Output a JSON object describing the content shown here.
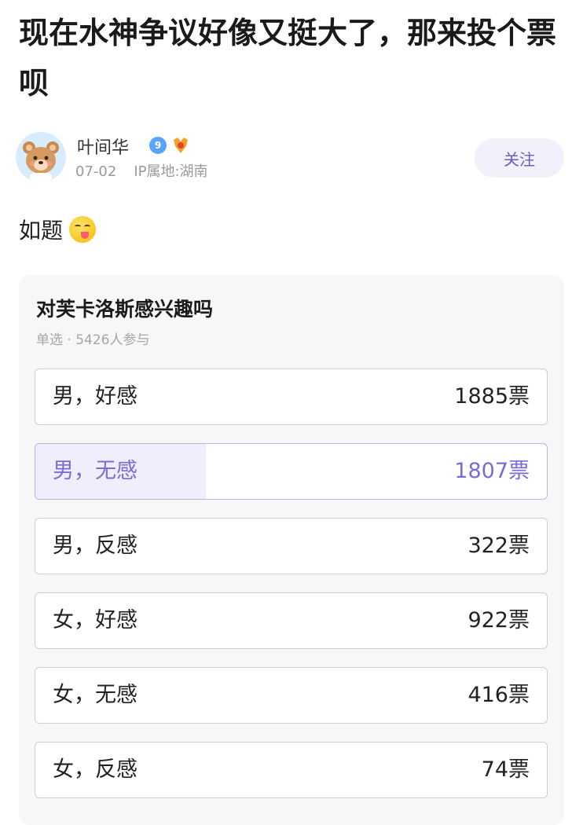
{
  "post": {
    "title": "现在水神争议好像又挺大了，那来投个票呗",
    "content": "如题",
    "emoji": "yum-face-emoji"
  },
  "author": {
    "name": "叶间华",
    "level": "9",
    "date": "07-02",
    "ip_location": "IP属地:湖南",
    "follow_label": "关注"
  },
  "poll": {
    "question": "对芙卡洛斯感兴趣吗",
    "meta": "单选 · 5426人参与",
    "total": 5426,
    "accent_color": "#7a6bd8",
    "options": [
      {
        "label": "男，好感",
        "votes": "1885票",
        "count": 1885,
        "selected": false
      },
      {
        "label": "男，无感",
        "votes": "1807票",
        "count": 1807,
        "selected": true
      },
      {
        "label": "男，反感",
        "votes": "322票",
        "count": 322,
        "selected": false
      },
      {
        "label": "女，好感",
        "votes": "922票",
        "count": 922,
        "selected": false
      },
      {
        "label": "女，无感",
        "votes": "416票",
        "count": 416,
        "selected": false
      },
      {
        "label": "女，反感",
        "votes": "74票",
        "count": 74,
        "selected": false
      }
    ]
  }
}
